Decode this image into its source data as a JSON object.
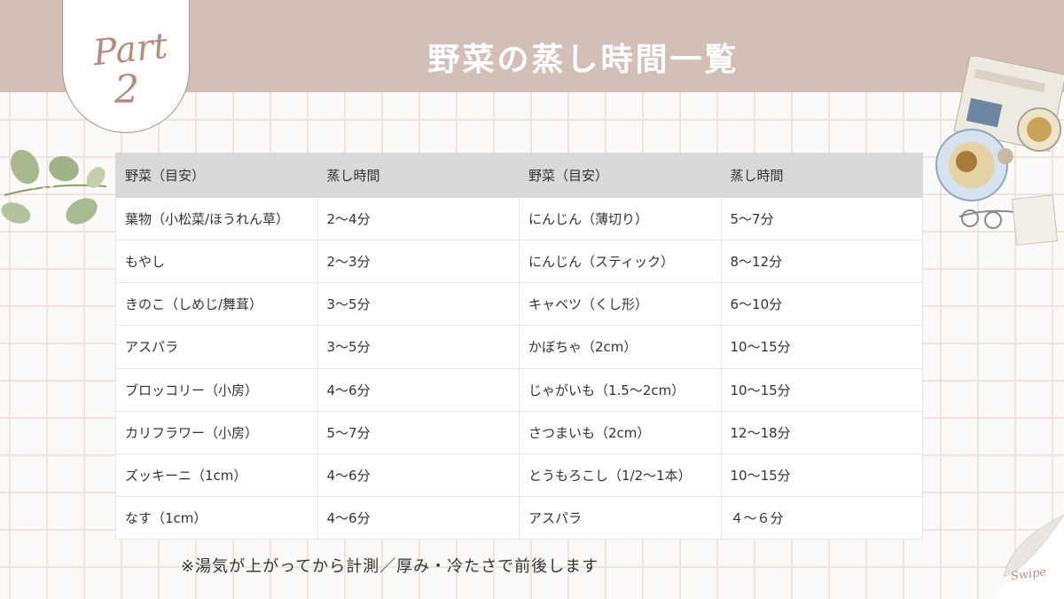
{
  "header": {
    "title": "野菜の蒸し時間一覧",
    "part_word": "Part",
    "part_number": "2"
  },
  "table": {
    "headers": [
      "野菜（目安）",
      "蒸し時間",
      "野菜（目安）",
      "蒸し時間"
    ],
    "rows": [
      [
        "葉物（小松菜/ほうれん草）",
        "2〜4分",
        "にんじん（薄切り）",
        "5〜7分"
      ],
      [
        "もやし",
        "2〜3分",
        "にんじん（スティック）",
        "8〜12分"
      ],
      [
        "きのこ（しめじ/舞茸）",
        "3〜5分",
        "キャベツ（くし形）",
        "6〜10分"
      ],
      [
        "アスパラ",
        "3〜5分",
        "かぼちゃ（2cm）",
        "10〜15分"
      ],
      [
        "ブロッコリー（小房）",
        "4〜6分",
        "じゃがいも（1.5〜2cm）",
        "10〜15分"
      ],
      [
        "カリフラワー（小房）",
        "5〜7分",
        "さつまいも（2cm）",
        "12〜18分"
      ],
      [
        "ズッキーニ（1cm）",
        "4〜6分",
        "とうもろこし（1/2〜1本）",
        "10〜15分"
      ],
      [
        "なす（1cm）",
        "4〜6分",
        "アスパラ",
        " ４〜６分"
      ]
    ]
  },
  "footer": {
    "note": "※湯気が上がってから計測／厚み・冷たさで前後します",
    "swipe_label": "Swipe"
  },
  "decorations": {
    "leaf_icon": "eucalyptus-branch",
    "tea_icon": "tea-and-newspaper-illustration",
    "curl_icon": "page-curl"
  },
  "colors": {
    "header_band": "#d3bfb8",
    "accent": "#b98b7e",
    "grid_line": "#f0e2dd",
    "table_header": "#d9d9d9"
  }
}
